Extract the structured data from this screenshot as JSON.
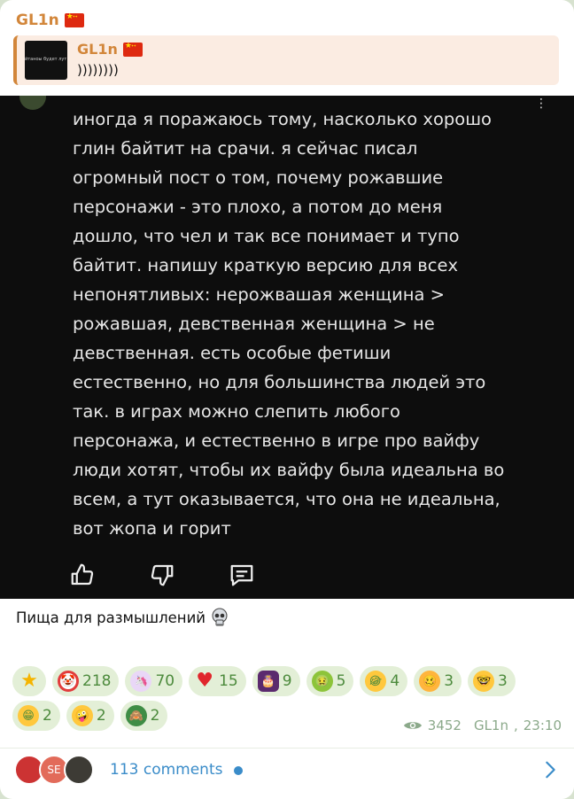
{
  "message": {
    "sender": "GL1n",
    "sender_flag": "china-flag-icon",
    "accent": "#d2863a",
    "reply": {
      "name": "GL1n",
      "text": "))))))))",
      "thumb_text": "йтаноы будет лут"
    },
    "screenshot": {
      "text": "иногда я поражаюсь тому, насколько хорошо\nглин байтит на срачи. я сейчас писал\nогромный пост о том, почему рожавшие\nперсонажи - это плохо, а потом до меня\nдошло, что чел и так все понимает и тупо\nбайтит. напишу краткую версию для всех\nнепонятливых: нерожвашая женщина >\nрожавшая, девственная женщина > не\nдевственная. есть особые фетиши\nестественно, но для большинства людей это\nтак. в играх можно слепить любого\nперсонажа, и естественно в игре про вайфу\nлюди хотят, чтобы их вайфу была идеальна во\nвсем, а тут оказывается, что она не идеальна,\nвот жопа и горит",
      "menu": "⋮"
    },
    "caption": "Пища для размышлений",
    "caption_icon": "skull-icon",
    "reactions": [
      {
        "icon": "star-icon",
        "glyph": "★",
        "count": "",
        "cls": "star"
      },
      {
        "icon": "clown-icon",
        "glyph": "🤡",
        "count": "218",
        "cls": "clown"
      },
      {
        "icon": "unicorn-icon",
        "glyph": "🦄",
        "count": "70",
        "cls": "unicorn"
      },
      {
        "icon": "heart-icon",
        "glyph": "♥",
        "count": "15",
        "cls": "heart"
      },
      {
        "icon": "cake-icon",
        "glyph": "🎂",
        "count": "9",
        "cls": "cake"
      },
      {
        "icon": "nauseated-icon",
        "glyph": "🤢",
        "count": "5",
        "cls": "sick"
      },
      {
        "icon": "rofl-icon",
        "glyph": "😂",
        "count": "4",
        "cls": "rofl"
      },
      {
        "icon": "woozy-icon",
        "glyph": "🥴",
        "count": "3",
        "cls": "woozy"
      },
      {
        "icon": "nerd-icon",
        "glyph": "🤓",
        "count": "3",
        "cls": "nerd"
      },
      {
        "icon": "grin-icon",
        "glyph": "😁",
        "count": "2",
        "cls": "grin"
      },
      {
        "icon": "zany-icon",
        "glyph": "🤪",
        "count": "2",
        "cls": "zany"
      },
      {
        "icon": "see-no-evil-icon",
        "glyph": "🙈",
        "count": "2",
        "cls": "monkey"
      }
    ],
    "views": "3452",
    "author": "GL1n",
    "time": "23:10",
    "comments": {
      "label": "113 comments",
      "avatar2_text": "SE"
    }
  }
}
